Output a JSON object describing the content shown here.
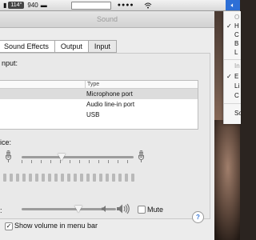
{
  "menubar": {
    "temperature": "114°",
    "counter": "940",
    "volume_icon": "speaker-icon"
  },
  "window": {
    "title": "Sound",
    "tabs": [
      "Sound Effects",
      "Output",
      "Input"
    ],
    "active_tab": "Input",
    "device_heading": "nput:",
    "column_header": "Type",
    "devices": [
      {
        "type": "Microphone port",
        "selected": true
      },
      {
        "type": "Audio line-in port",
        "selected": false
      },
      {
        "type": "USB",
        "selected": false
      }
    ],
    "input_volume_label": "ice:",
    "input_volume_fraction": 0.36,
    "output_volume_label": ":",
    "output_volume_fraction": 0.6,
    "mute_label": "Mute",
    "mute_checked": false,
    "show_volume_label": "Show volume in menu bar",
    "show_volume_checked": true,
    "help_label": "?",
    "checkmark": "✓"
  },
  "menu": {
    "items": [
      {
        "text": "O",
        "muted": true,
        "check": ""
      },
      {
        "text": "H",
        "muted": false,
        "check": "✓"
      },
      {
        "text": "C",
        "muted": false,
        "check": ""
      },
      {
        "text": "B",
        "muted": false,
        "check": ""
      },
      {
        "text": "L",
        "muted": false,
        "check": ""
      },
      {
        "text": "In",
        "muted": true,
        "check": ""
      },
      {
        "text": "E",
        "muted": false,
        "check": "✓"
      },
      {
        "text": "Li",
        "muted": false,
        "check": ""
      },
      {
        "text": "C",
        "muted": false,
        "check": ""
      },
      {
        "text": "So",
        "muted": false,
        "check": ""
      }
    ]
  }
}
